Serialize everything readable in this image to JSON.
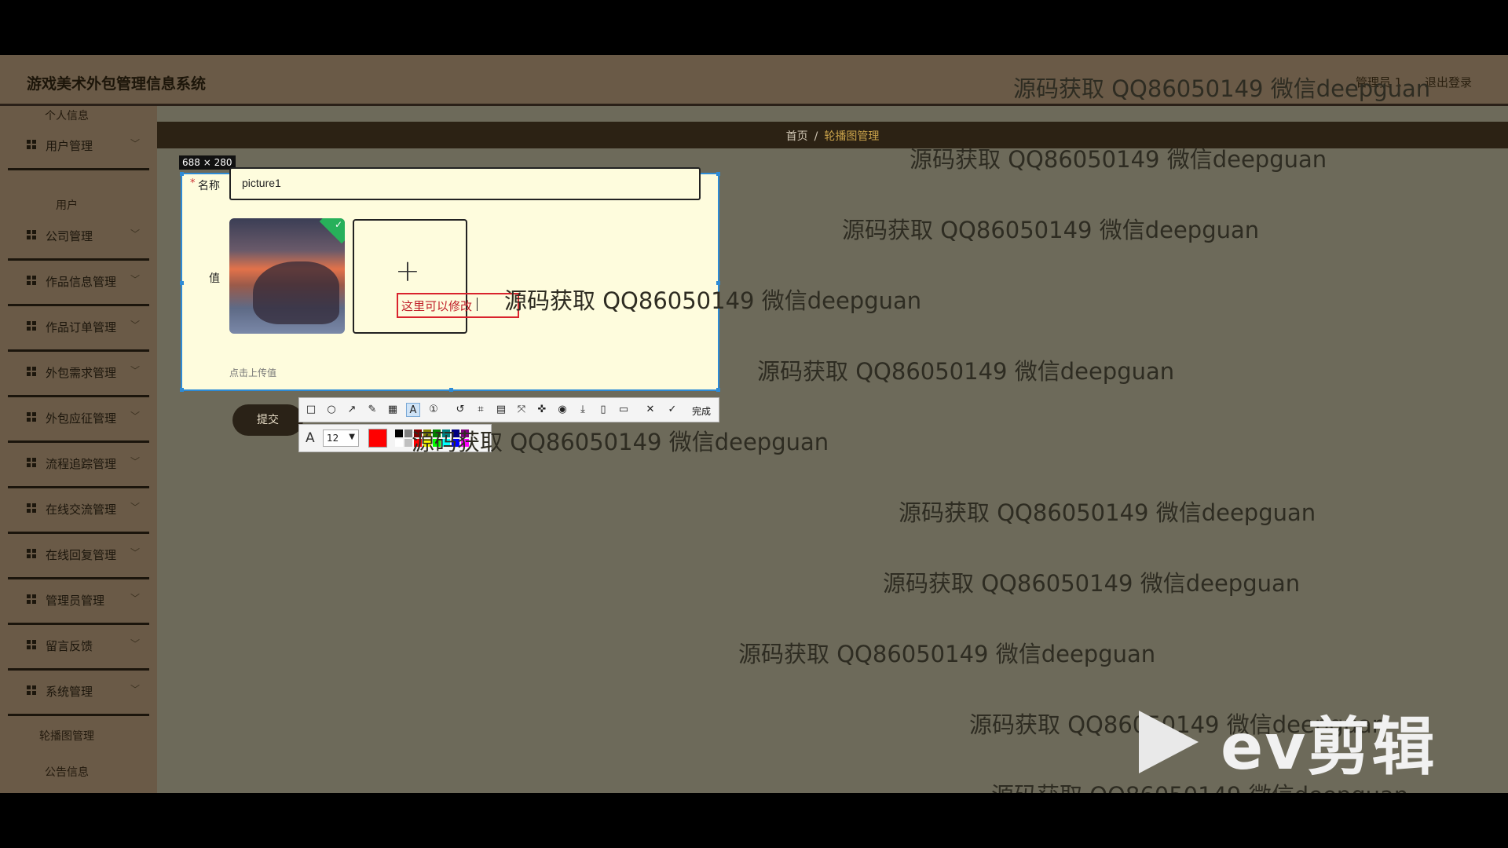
{
  "app": {
    "title": "游戏美术外包管理信息系统"
  },
  "topbar": {
    "user": "管理员 1",
    "logout": "退出登录"
  },
  "sidebar": {
    "top_partial": "个人信息",
    "items": [
      {
        "label": "用户管理",
        "sub": "用户"
      },
      {
        "label": "公司管理"
      },
      {
        "label": "作品信息管理"
      },
      {
        "label": "作品订单管理"
      },
      {
        "label": "外包需求管理"
      },
      {
        "label": "外包应征管理"
      },
      {
        "label": "流程追踪管理"
      },
      {
        "label": "在线交流管理"
      },
      {
        "label": "在线回复管理"
      },
      {
        "label": "管理员管理"
      },
      {
        "label": "留言反馈"
      },
      {
        "label": "系统管理"
      }
    ],
    "subitems_after": [
      "轮播图管理",
      "公告信息"
    ],
    "chevron": "chevron-down-icon"
  },
  "breadcrumb": {
    "home": "首页",
    "separator": "/",
    "current": "轮播图管理"
  },
  "capture": {
    "size_label": "688 × 280"
  },
  "form": {
    "name_label": "名称",
    "name_value": "picture1",
    "value_label": "值",
    "upload_hint": "点击上传值",
    "submit": "提交",
    "annotation_text": "这里可以修改"
  },
  "toolbar": {
    "done": "完成",
    "font_size": "12",
    "current_color": "#ff0000",
    "icons": [
      "rect-icon",
      "ellipse-icon",
      "arrow-icon",
      "pencil-icon",
      "mosaic-icon",
      "text-icon",
      "number-icon",
      "undo-icon",
      "crop-icon",
      "ocr-icon",
      "scroll-icon",
      "pin-icon",
      "record-icon",
      "download-icon",
      "copy-icon",
      "bookmark-icon",
      "close-icon",
      "check-icon"
    ]
  },
  "watermark": {
    "text": "源码获取 QQ86050149 微信deepguan"
  },
  "logo": {
    "text": "ev剪辑"
  }
}
